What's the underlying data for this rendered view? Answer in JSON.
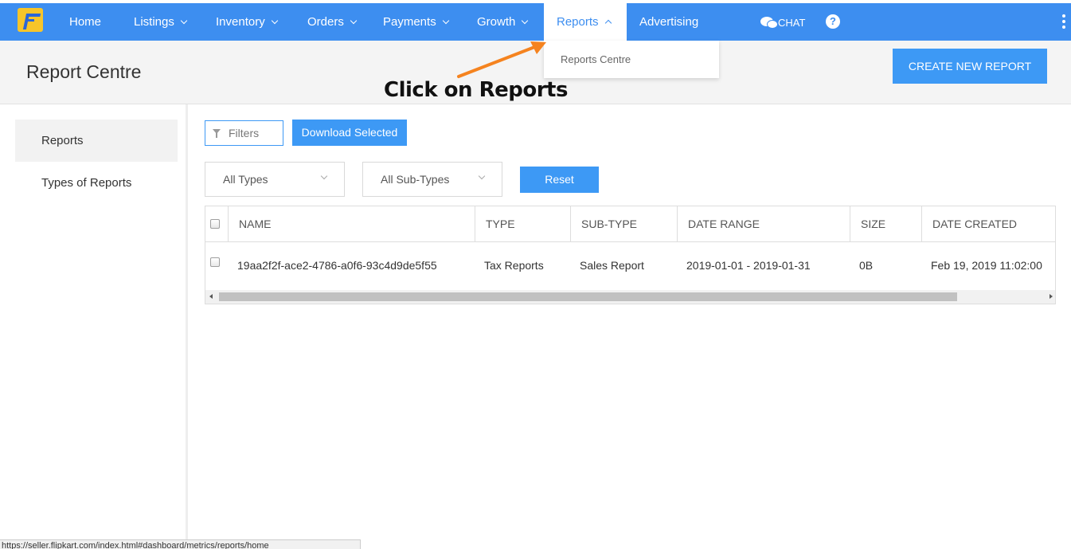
{
  "nav": {
    "items": [
      {
        "label": "Home",
        "has_menu": false
      },
      {
        "label": "Listings",
        "has_menu": true
      },
      {
        "label": "Inventory",
        "has_menu": true
      },
      {
        "label": "Orders",
        "has_menu": true
      },
      {
        "label": "Payments",
        "has_menu": true
      },
      {
        "label": "Growth",
        "has_menu": true
      },
      {
        "label": "Reports",
        "has_menu": true,
        "active": true
      },
      {
        "label": "Advertising",
        "has_menu": false
      }
    ],
    "chat_label": "CHAT",
    "help_glyph": "?",
    "accent_color": "#3d8ef0"
  },
  "dropdown": {
    "items": [
      "Reports Centre"
    ]
  },
  "annotation": {
    "text": "Click on Reports",
    "arrow_color": "#f5831f"
  },
  "header": {
    "title": "Report Centre",
    "create_button": "CREATE NEW REPORT"
  },
  "sidebar": {
    "items": [
      {
        "label": "Reports",
        "active": true
      },
      {
        "label": "Types of Reports",
        "active": false
      }
    ]
  },
  "toolbar": {
    "filters_label": "Filters",
    "download_label": "Download Selected",
    "type_select": "All Types",
    "subtype_select": "All Sub-Types",
    "reset_label": "Reset"
  },
  "table": {
    "columns": [
      "NAME",
      "TYPE",
      "SUB-TYPE",
      "DATE RANGE",
      "SIZE",
      "DATE CREATED"
    ],
    "rows": [
      {
        "name": "19aa2f2f-ace2-4786-a0f6-93c4d9de5f55",
        "type": "Tax Reports",
        "sub_type": "Sales Report",
        "date_range": "2019-01-01 - 2019-01-31",
        "size": "0B",
        "date_created": "Feb 19, 2019 11:02:00"
      }
    ]
  },
  "statusbar": {
    "url": "https://seller.flipkart.com/index.html#dashboard/metrics/reports/home"
  }
}
